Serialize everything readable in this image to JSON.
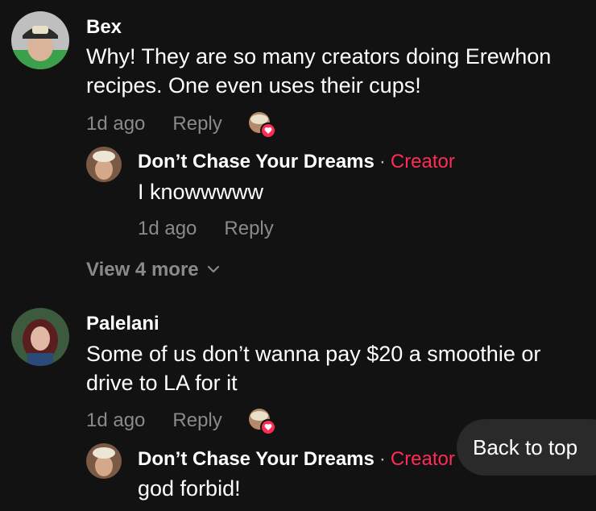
{
  "comments": [
    {
      "author": "Bex",
      "text": "Why! They are so many creators doing Erewhon recipes. One even uses their cups!",
      "time": "1d ago",
      "reply_label": "Reply",
      "reply": {
        "author": "Don’t Chase Your Dreams",
        "separator": "·",
        "badge": "Creator",
        "text": "I knowwwww",
        "time": "1d ago",
        "reply_label": "Reply"
      }
    },
    {
      "author": "Palelani",
      "text": "Some of us don’t wanna pay $20 a smoothie or drive to LA for it",
      "time": "1d ago",
      "reply_label": "Reply",
      "reply": {
        "author": "Don’t Chase Your Dreams",
        "separator": "·",
        "badge": "Creator",
        "text": "god forbid!"
      }
    }
  ],
  "view_more_label": "View 4 more",
  "back_to_top_label": "Back to top",
  "colors": {
    "background": "#121212",
    "muted": "#8a8a8a",
    "accent": "#fe2c55",
    "pill": "#2a2a2a"
  },
  "icons": {
    "creator_liked": "heart-badge-icon",
    "view_more": "chevron-down-icon"
  }
}
